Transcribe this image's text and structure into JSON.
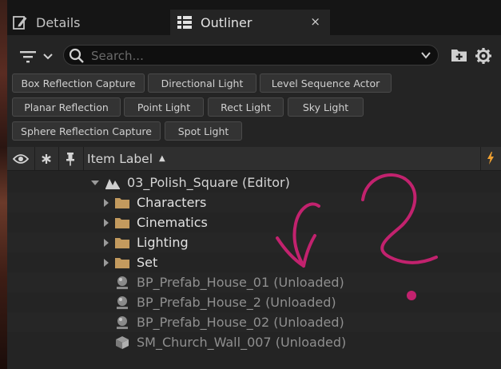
{
  "tabs": {
    "details": {
      "label": "Details",
      "icon": "pencil-icon"
    },
    "outliner": {
      "label": "Outliner",
      "icon": "outliner-list-icon",
      "close": "×"
    }
  },
  "toolbar": {
    "search_placeholder": "Search...",
    "filter_icon": "filter-icon",
    "add_folder_icon": "add-folder-icon",
    "settings_icon": "gear-icon"
  },
  "filters": [
    "Box Reflection Capture",
    "Directional Light",
    "Level Sequence Actor",
    "Planar Reflection",
    "Point Light",
    "Rect Light",
    "Sky Light",
    "Sphere Reflection Capture",
    "Spot Light"
  ],
  "columns": {
    "visibility_icon": "eye-icon",
    "star_icon": "star-icon",
    "pin_icon": "pin-icon",
    "item_label": "Item Label",
    "sort": "ascending",
    "lightning_icon": "lightning-icon"
  },
  "tree": {
    "world": "03_Polish_Square (Editor)",
    "folders": [
      "Characters",
      "Cinematics",
      "Lighting",
      "Set"
    ],
    "actors": [
      {
        "label": "BP_Prefab_House_01 (Unloaded)",
        "icon": "actor-icon"
      },
      {
        "label": "BP_Prefab_House_2 (Unloaded)",
        "icon": "actor-icon"
      },
      {
        "label": "BP_Prefab_House_02 (Unloaded)",
        "icon": "actor-icon"
      },
      {
        "label": "SM_Church_Wall_007 (Unloaded)",
        "icon": "static-mesh-icon"
      }
    ]
  },
  "colors": {
    "folder": "#c39a5e",
    "accent_lightning": "#f0a030",
    "annotation": "#c2226e",
    "panel_bg": "#242424"
  }
}
